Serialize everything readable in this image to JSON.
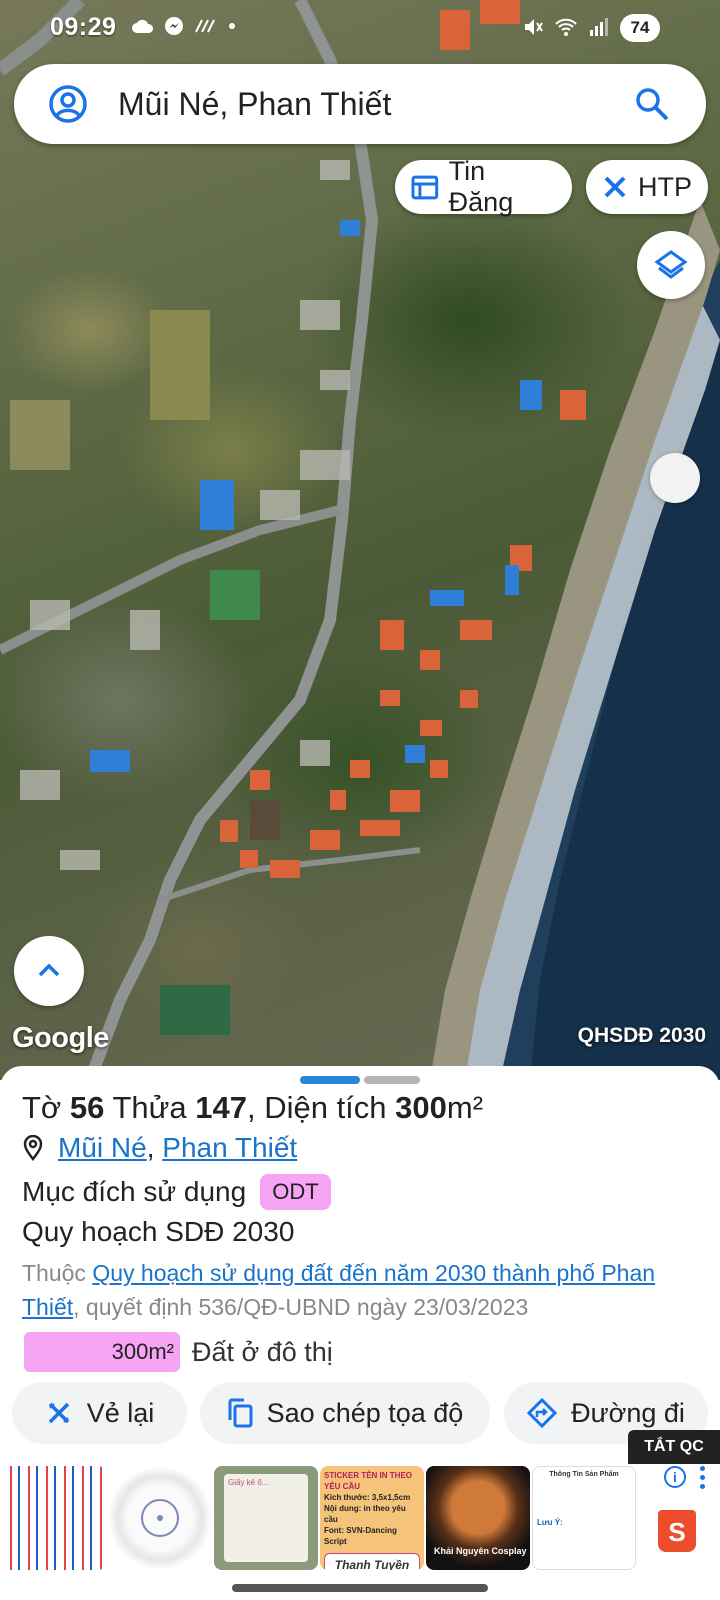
{
  "status_bar": {
    "time": "09:29",
    "battery": "74",
    "icons": [
      "cloud-icon",
      "messenger-icon",
      "no-signal-icon",
      "dot-icon",
      "mute-icon",
      "wifi-icon",
      "signal-icon",
      "battery-icon"
    ]
  },
  "search": {
    "query": "Mũi Né, Phan Thiết"
  },
  "chips": {
    "tin_dang": "Tin Đăng",
    "htp": "HTP"
  },
  "map": {
    "attribution": "Google",
    "layer_label": "QHSDĐ 2030"
  },
  "parcel": {
    "to_label": "Tờ",
    "to_value": "56",
    "thua_label": "Thửa",
    "thua_value": "147",
    "area_label": ", Diện tích",
    "area_value": "300",
    "area_unit": "m²",
    "location_link_1": "Mũi Né",
    "location_sep": ",",
    "location_link_2": "Phan Thiết",
    "purpose_label": "Mục đích sử dụng",
    "purpose_code": "ODT",
    "plan_title": "Quy hoạch SDĐ 2030",
    "plan_prefix": "Thuộc",
    "plan_link": "Quy hoạch sử dụng đất đến năm 2030 thành phố Phan Thiết",
    "plan_suffix": ", quyết định 536/QĐ-UBND ngày 23/03/2023",
    "legend_area": "300m²",
    "legend_label": "Đất ở đô thị"
  },
  "actions": {
    "redraw": "Vẻ lại",
    "copy_coords": "Sao chép tọa độ",
    "directions": "Đường đi"
  },
  "ad": {
    "close_label": "TẮT QC",
    "ad3_text": "Giấy kẻ ô...",
    "ad4_line1": "STICKER TÊN IN THEO YÊU CẦU",
    "ad4_line2": "Kích thước: 3,5x1,5cm",
    "ad4_line3": "Nội dung: in theo yêu cầu",
    "ad4_line4": "Font: SVN-Dancing Script",
    "ad4_name": "Thanh Tuyền",
    "ad5_text": "Khải Nguyên Cosplay",
    "ad6_title": "Thông Tin Sản Phẩm",
    "ad6_note": "Lưu Ý:"
  },
  "colors": {
    "accent": "#1a73c8",
    "badge_pink": "#f6a5f4",
    "handle_active": "#2a86d6"
  }
}
